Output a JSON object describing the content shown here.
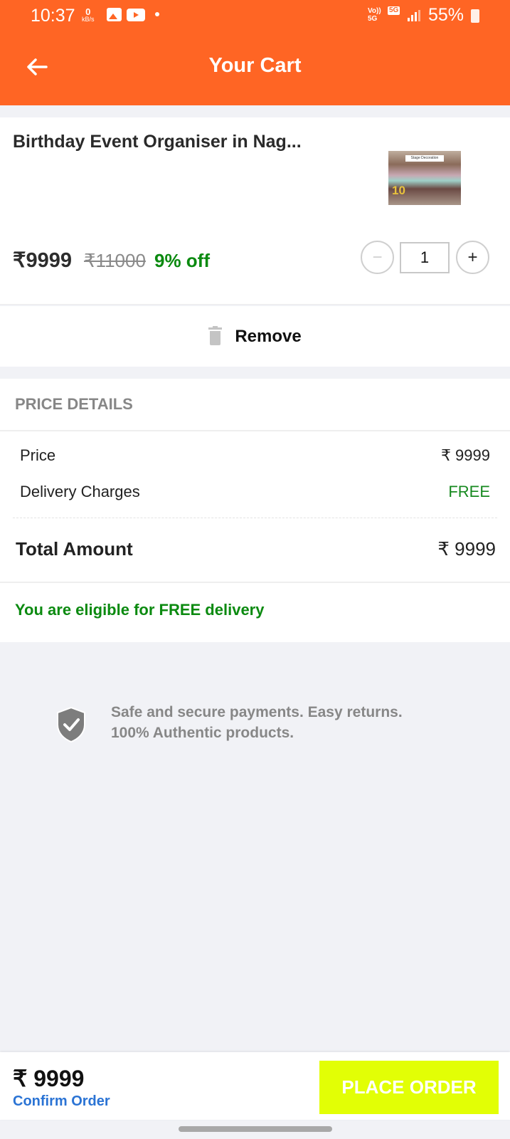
{
  "status_bar": {
    "time": "10:37",
    "net_speed_value": "0",
    "net_speed_unit": "kB/s",
    "volte": "Vo))",
    "volte_sub": "5G",
    "network": "5G",
    "battery": "55%"
  },
  "header": {
    "title": "Your Cart",
    "back_icon": "arrow-left-icon",
    "background_color": "#ff6524"
  },
  "cart_item": {
    "title": "Birthday Event Organiser in Nag...",
    "thumbnail_label": "Stage Decoration",
    "thumbnail_number": "10",
    "price": "₹9999",
    "original_price": "₹11000",
    "discount": "9% off",
    "quantity": "1",
    "minus_label": "−",
    "plus_label": "+",
    "remove_label": "Remove",
    "remove_icon": "trash-icon"
  },
  "price_details": {
    "heading": "PRICE DETAILS",
    "rows": [
      {
        "label": "Price",
        "value": "₹ 9999"
      },
      {
        "label": "Delivery Charges",
        "value": "FREE"
      }
    ],
    "total_label": "Total Amount",
    "total_value": "₹ 9999",
    "eligibility": "You are eligible for FREE delivery"
  },
  "secure_note": {
    "icon": "shield-check-icon",
    "line1": "Safe and secure payments. Easy returns.",
    "line2": "100% Authentic products."
  },
  "bottom_bar": {
    "total": "₹ 9999",
    "confirm_label": "Confirm Order",
    "place_order_label": "PLACE ORDER",
    "place_order_color": "#e2ff05"
  }
}
